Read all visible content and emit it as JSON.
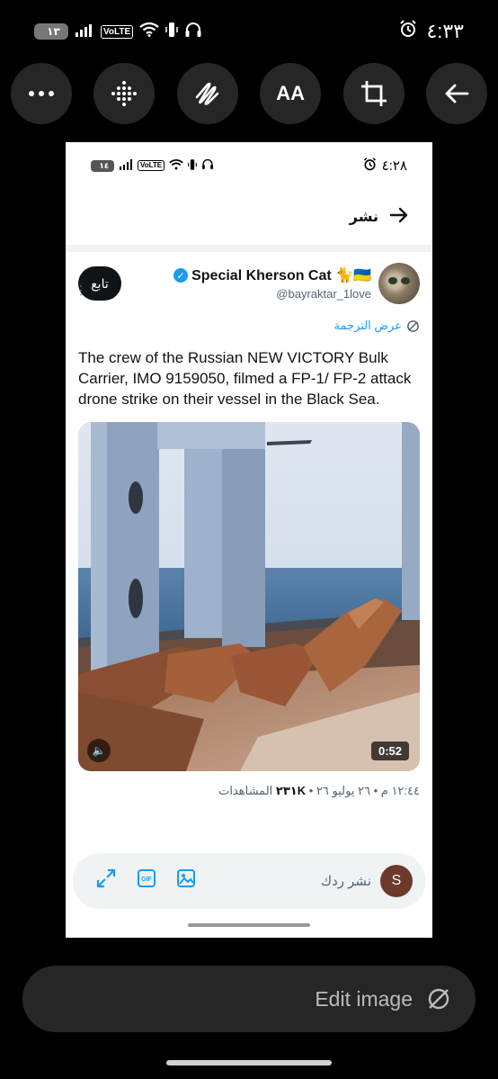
{
  "status_bar": {
    "time": "٤:٣٣",
    "battery": "١٣",
    "battery_level": 0.13,
    "network": "VoLTE"
  },
  "toolbar": {
    "items": [
      {
        "icon": "more-icon"
      },
      {
        "icon": "grid-dots-icon"
      },
      {
        "icon": "draw-icon"
      },
      {
        "icon": "text-size-icon",
        "label": "AA"
      },
      {
        "icon": "crop-icon"
      },
      {
        "icon": "back-arrow-icon"
      }
    ]
  },
  "screenshot": {
    "status_bar": {
      "time": "٤:٢٨",
      "battery": "١٤",
      "battery_level": 0.14,
      "network": "VoLTE"
    },
    "header": {
      "title": "نشر"
    },
    "tweet": {
      "follow_label": "تابع",
      "display_name": "Special Kherson Cat 🐈🇺🇦",
      "handle": "@bayraktar_1love",
      "translate_label": "عرض الترجمة",
      "text": "The crew of the Russian NEW VICTORY Bulk Carrier, IMO 9159050, filmed a FP-1/ FP-2 attack drone strike on their vessel in the Black Sea.",
      "video_duration": "0:52",
      "meta_time": "١٢:٤٤ م • ٢٦ يوليو ٢٦ •",
      "meta_views_count": "٢٣١K",
      "meta_views_label": "المشاهدات"
    },
    "reply_bar": {
      "placeholder": "نشر ردك",
      "avatar_letter": "S",
      "gif_label": "GIF"
    }
  },
  "edit_bar": {
    "label": "Edit image"
  }
}
